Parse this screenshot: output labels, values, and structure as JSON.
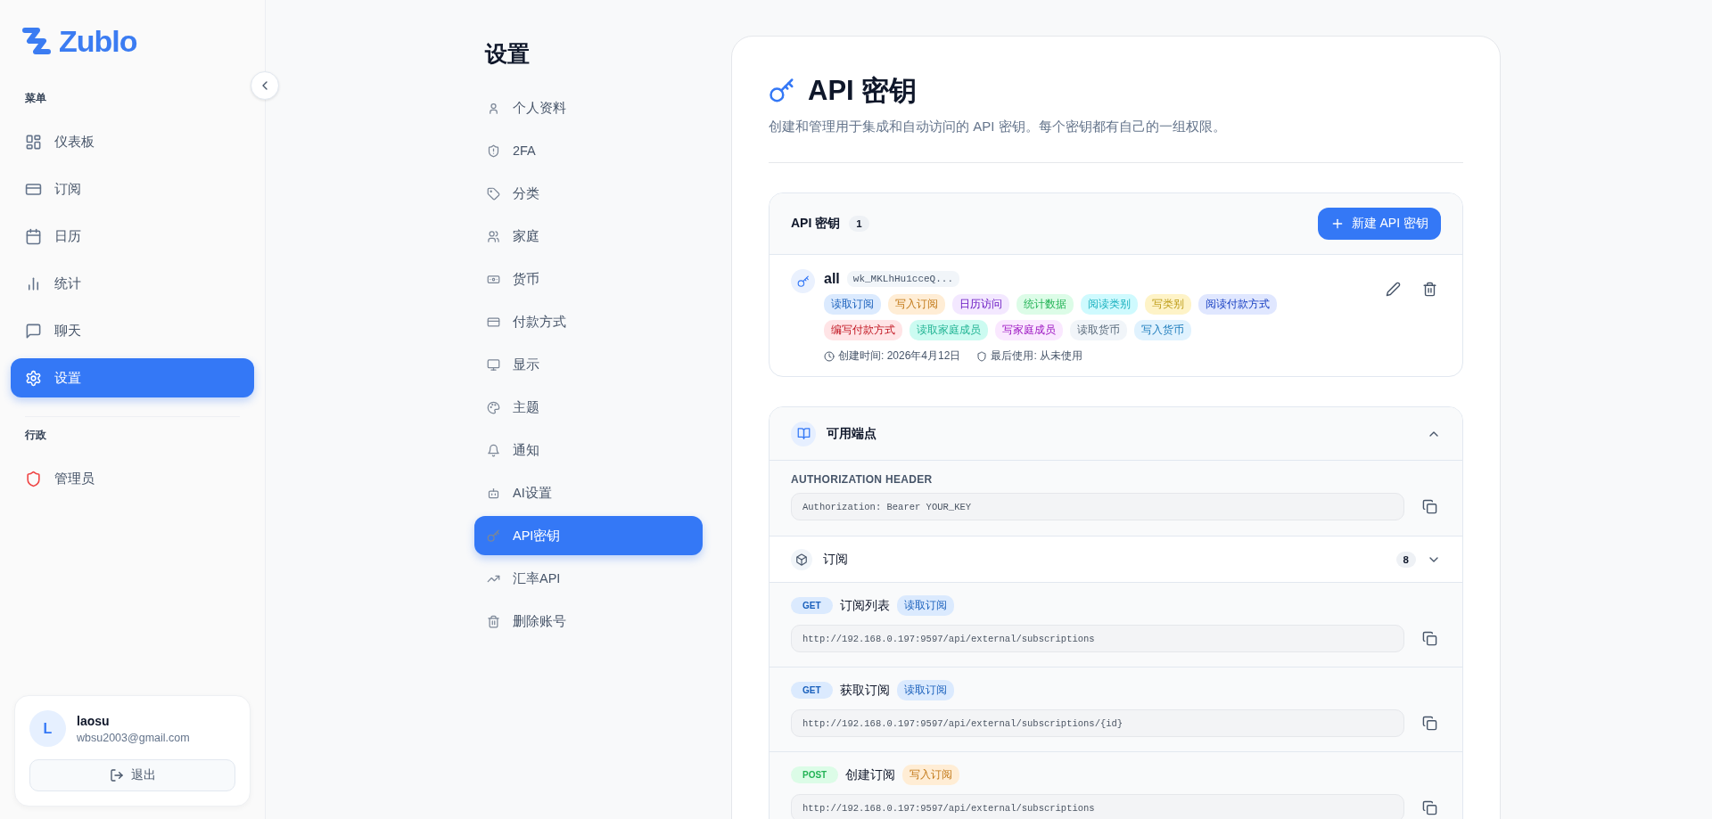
{
  "sidebar": {
    "logo": "Zublo",
    "sections": [
      {
        "title": "菜单",
        "items": [
          {
            "label": "仪表板",
            "selected": false
          },
          {
            "label": "订阅",
            "selected": false
          },
          {
            "label": "日历",
            "selected": false
          },
          {
            "label": "统计",
            "selected": false
          },
          {
            "label": "聊天",
            "selected": false
          },
          {
            "label": "设置",
            "selected": true
          }
        ]
      },
      {
        "title": "行政",
        "items": [
          {
            "label": "管理员",
            "selected": false
          }
        ]
      }
    ],
    "user": {
      "initial": "L",
      "name": "laosu",
      "email": "wbsu2003@gmail.com",
      "logout": "退出"
    }
  },
  "settings_nav": {
    "title": "设置",
    "items": [
      {
        "label": "个人资料",
        "selected": false
      },
      {
        "label": "2FA",
        "selected": false
      },
      {
        "label": "分类",
        "selected": false
      },
      {
        "label": "家庭",
        "selected": false
      },
      {
        "label": "货币",
        "selected": false
      },
      {
        "label": "付款方式",
        "selected": false
      },
      {
        "label": "显示",
        "selected": false
      },
      {
        "label": "主题",
        "selected": false
      },
      {
        "label": "通知",
        "selected": false
      },
      {
        "label": "AI设置",
        "selected": false
      },
      {
        "label": "API密钥",
        "selected": true
      },
      {
        "label": "汇率API",
        "selected": false
      },
      {
        "label": "删除账号",
        "selected": false
      }
    ]
  },
  "page": {
    "title": "API 密钥",
    "subtitle": "创建和管理用于集成和自动访问的 API 密钥。每个密钥都有自己的一组权限。"
  },
  "keys_card": {
    "title": "API 密钥",
    "count": "1",
    "new_button": "新建 API 密钥",
    "keys": [
      {
        "name": "all",
        "prefix": "wk_MKLhHu1cceQ...",
        "created": "创建时间: 2026年4月12日",
        "last_used": "最后使用: 从未使用",
        "scopes": [
          {
            "label": "读取订阅",
            "color": "#dbeafe"
          },
          {
            "label": "写入订阅",
            "color": "#ffedd5"
          },
          {
            "label": "日历访问",
            "color": "#f3e8ff"
          },
          {
            "label": "统计数据",
            "color": "#dcfce7"
          },
          {
            "label": "阅读类别",
            "color": "#cffafe"
          },
          {
            "label": "写类别",
            "color": "#fef3c7"
          },
          {
            "label": "阅读付款方式",
            "color": "#e0e7ff"
          },
          {
            "label": "编写付款方式",
            "color": "#ffe4e6"
          },
          {
            "label": "读取家庭成员",
            "color": "#ccfbf1"
          },
          {
            "label": "写家庭成员",
            "color": "#fae8ff"
          },
          {
            "label": "读取货币",
            "color": "#f1f5f9"
          },
          {
            "label": "写入货币",
            "color": "#e0f2fe"
          }
        ]
      }
    ]
  },
  "endpoints_card": {
    "title": "可用端点",
    "auth_label": "AUTHORIZATION HEADER",
    "auth_value": "Authorization: Bearer YOUR_KEY",
    "groups": [
      {
        "title": "订阅",
        "count": "8",
        "endpoints": [
          {
            "method": {
              "label": "GET",
              "color": "#dbeafe"
            },
            "name": "订阅列表",
            "scope": {
              "label": "读取订阅",
              "color": "#dbeafe"
            },
            "url": "http://192.168.0.197:9597/api/external/subscriptions"
          },
          {
            "method": {
              "label": "GET",
              "color": "#dbeafe"
            },
            "name": "获取订阅",
            "scope": {
              "label": "读取订阅",
              "color": "#dbeafe"
            },
            "url": "http://192.168.0.197:9597/api/external/subscriptions/{id}"
          },
          {
            "method": {
              "label": "POST",
              "color": "#dcfce7"
            },
            "name": "创建订阅",
            "scope": {
              "label": "写入订阅",
              "color": "#ffedd5"
            },
            "url": "http://192.168.0.197:9597/api/external/subscriptions"
          }
        ]
      }
    ]
  }
}
